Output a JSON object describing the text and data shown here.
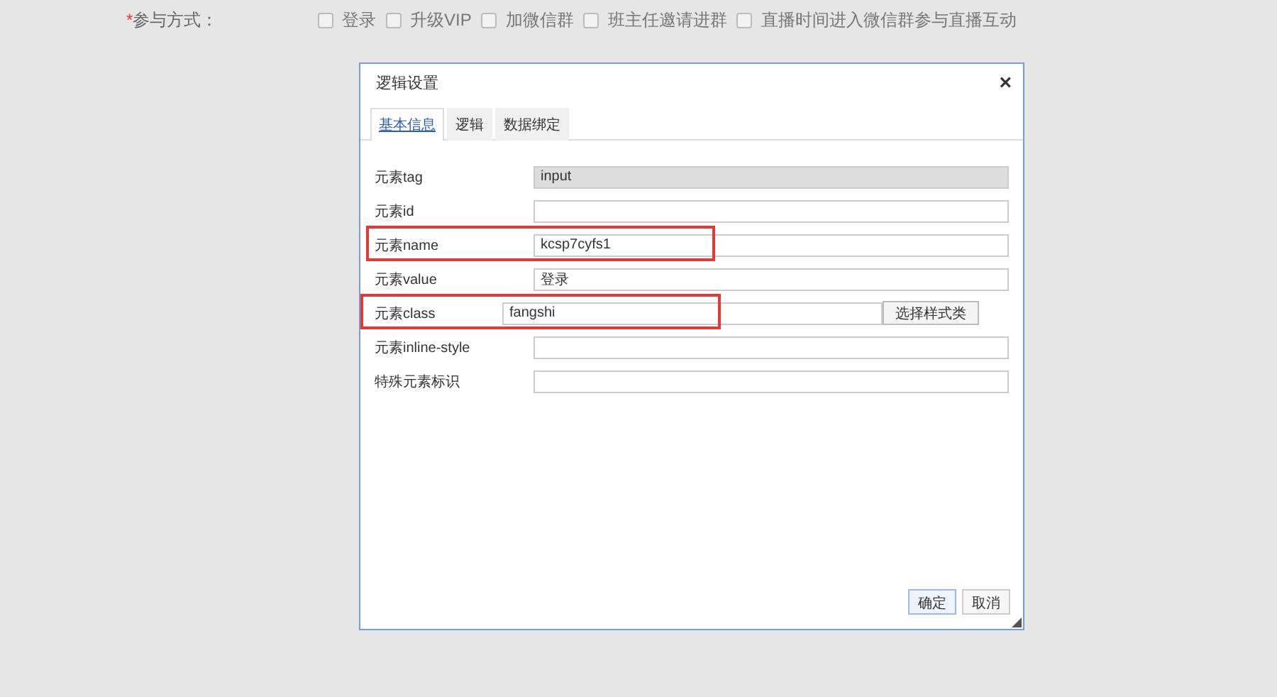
{
  "form_row": {
    "required_mark": "*",
    "label": "参与方式：",
    "options": [
      {
        "label": "登录",
        "checked": false
      },
      {
        "label": "升级VIP",
        "checked": false
      },
      {
        "label": "加微信群",
        "checked": false
      },
      {
        "label": "班主任邀请进群",
        "checked": false
      },
      {
        "label": "直播时间进入微信群参与直播互动",
        "checked": false
      }
    ]
  },
  "dialog": {
    "title": "逻辑设置",
    "close": "×",
    "tabs": [
      {
        "label": "基本信息",
        "selected": true
      },
      {
        "label": "逻辑",
        "selected": false
      },
      {
        "label": "数据绑定",
        "selected": false
      }
    ],
    "fields": [
      {
        "kind": "text",
        "label": "元素tag",
        "value": "input",
        "disabled": true,
        "highlighted": false
      },
      {
        "kind": "text",
        "label": "元素id",
        "disabled": false,
        "highlighted": false
      },
      {
        "kind": "text",
        "label": "元素name",
        "value": "kcsp7cyfs1",
        "disabled": false,
        "highlighted": true
      },
      {
        "kind": "text",
        "label": "元素value",
        "value": "登录",
        "disabled": false,
        "highlighted": false
      },
      {
        "kind": "picker",
        "label": "元素class",
        "value": "fangshi",
        "button": "选择样式类",
        "disabled": false,
        "highlighted": true
      },
      {
        "kind": "text",
        "label": "元素inline-style",
        "disabled": false,
        "highlighted": false
      },
      {
        "kind": "text",
        "label": "特殊元素标识",
        "disabled": false,
        "highlighted": false
      }
    ],
    "buttons": [
      {
        "label": "确定",
        "primary": true
      },
      {
        "label": "取消",
        "primary": false
      }
    ]
  }
}
